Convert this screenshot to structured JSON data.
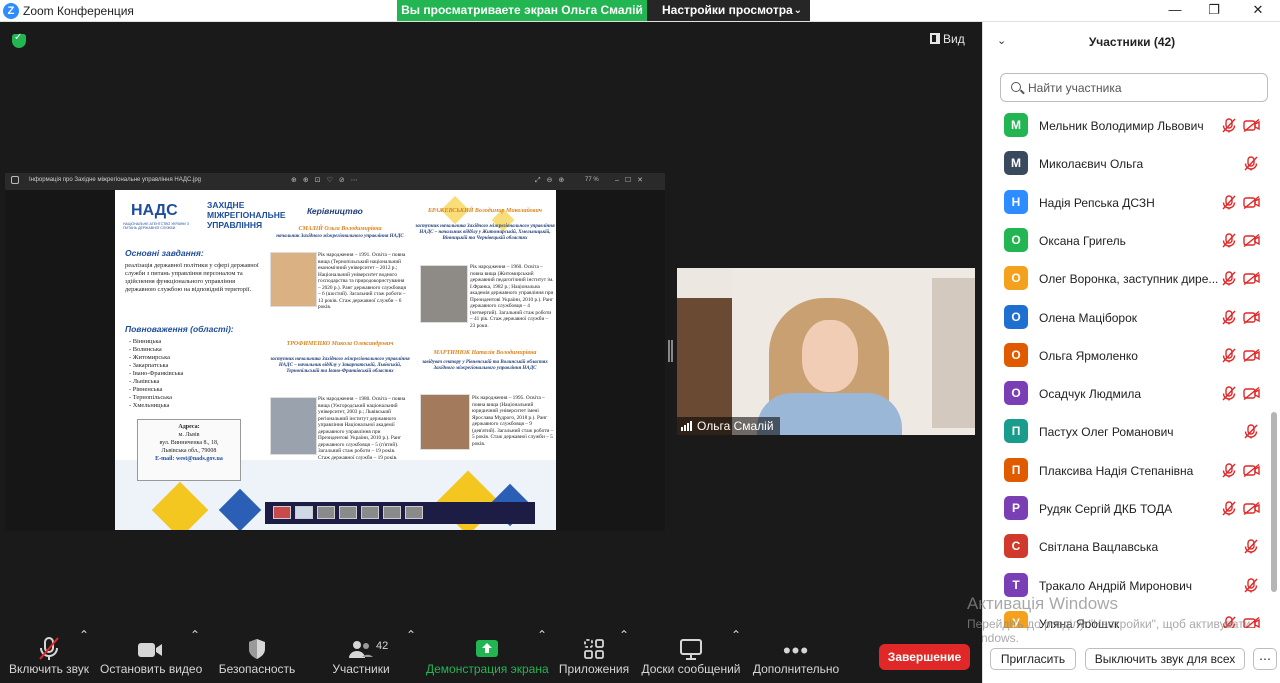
{
  "window": {
    "title": "Zoom Конференция",
    "share_banner": "Вы просматриваете экран Ольга Смалій",
    "view_settings": "Настройки просмотра"
  },
  "stage": {
    "view_label": "Вид",
    "camera_name": "Ольга Смалій",
    "share_filename": "Інформація про Західне міжрегіональне управління НАДС.jpg",
    "zoom_level": "77 %"
  },
  "document": {
    "logo": "НАДС",
    "logo_sub": "НАЦІОНАЛЬНЕ АГЕНТСТВО УКРАЇНИ З ПИТАНЬ ДЕРЖАВНОЇ СЛУЖБИ",
    "org": "ЗАХІДНЕ МІЖРЕГІОНАЛЬНЕ УПРАВЛІННЯ",
    "main_tasks_title": "Основні завдання:",
    "main_tasks_text": "реалізація державної політики у сфері державної служби з питань управління персоналом та здійснення функціонального управління державною службою на відповідній території.",
    "powers_title": "Повноваження (області):",
    "regions": [
      "- Вінницька",
      "- Волинська",
      "- Житомирська",
      "- Закарпатська",
      "- Івано-Франківська",
      "- Львівська",
      "- Рівненська",
      "- Тернопільська",
      "- Хмельницька"
    ],
    "address_title": "Адреса:",
    "address_lines": [
      "м. Львів",
      "вул. Винниченка 8., 18,",
      "Львівська обл., 79008"
    ],
    "email": "E-mail: west@nads.gov.ua",
    "leadership_title": "Керівництво",
    "p1_name": "СМАЛІЙ Ольга Володимирівна",
    "p1_pos": "начальник Західного міжрегіонального управління НАДС",
    "p1_bio": "Рік народження – 1991. Освіта – повна вища (Тернопільський національний економічний університет – 2012 р.; Національний університет водного господарства та природокористування – 2020 р.). Ранг державного службовця – 6 (шостий). Загальний стаж роботи – 13 років. Стаж державної служби – 6 років.",
    "p2_name": "ТРОФИМЕНКО Микола Олександрович",
    "p2_pos": "заступник начальника Західного міжрегіонального управління НАДС – начальник відділу у Закарпатській, Львівській, Тернопільській та Івано-Франківській областях",
    "p2_bio": "Рік народження – 1980. Освіта – повна вища (Ужгородський національний університет, 2003 р.; Львівський регіональний інститут державного управління Національної академії державного управління при Президентові України, 2010 р.). Ранг державного службовця – 5 (п'ятий). Загальний стаж роботи – 19 років. Стаж державної служби – 19 років.",
    "p3_name": "БРАЖЕВСЬКИЙ Володимир Миколайович",
    "p3_pos": "заступник начальника Західного міжрегіонального управління НАДС – начальник відділу у Житомирській, Хмельницькій, Вінницькій та Чернівецькій областях",
    "p3_bio": "Рік народження – 1960. Освіта – повна вища (Житомирський державний педагогічний інститут ім. І.Франка, 1982 р.; Національна академія державного управління при Президентові України, 2010 р.). Ранг державного службовця – 4 (четвертий). Загальний стаж роботи – 41 рік. Стаж державної служби – 23 роки.",
    "p4_name": "МАРТИНЮК Наталія Володимирівна",
    "p4_pos": "завідувач сектору у Рівненській та Волинській областях Західного міжрегіонального управління НАДС",
    "p4_bio": "Рік народження – 1995. Освіта – повна вища (Національний юридичний університет імені Ярослава Мудрого, 2018 р.). Ранг державного службовця – 9 (дев'ятий). Загальний стаж роботи – 5 років. Стаж державної служби – 5 років."
  },
  "panel": {
    "title": "Участники (42)",
    "search_placeholder": "Найти участника",
    "participants": [
      {
        "initial": "М",
        "name": "Мельник Володимир Львович",
        "color": "#23b552",
        "video": true
      },
      {
        "initial": "М",
        "name": "Миколаєвич Ольга",
        "color": "#3a4a5e",
        "video": false
      },
      {
        "initial": "Н",
        "name": "Надія Репська ДСЗН",
        "color": "#2d8cff",
        "video": true
      },
      {
        "initial": "О",
        "name": "Оксана Григель",
        "color": "#23b552",
        "video": true
      },
      {
        "initial": "О",
        "name": "Олег Воронка, заступник дире...",
        "color": "#f4a11d",
        "video": true
      },
      {
        "initial": "О",
        "name": "Олена Маціборок",
        "color": "#1e6fcf",
        "video": true
      },
      {
        "initial": "О",
        "name": "Ольга Ярмоленко",
        "color": "#e05a00",
        "video": true
      },
      {
        "initial": "О",
        "name": "Осадчук Людмила",
        "color": "#7b3fb5",
        "video": true
      },
      {
        "initial": "П",
        "name": "Пастух Олег Романович",
        "color": "#1a9c8c",
        "video": false
      },
      {
        "initial": "П",
        "name": "Плаксива Надія Степанівна",
        "color": "#e05a00",
        "video": true
      },
      {
        "initial": "Р",
        "name": "Рудяк Сергій ДКБ ТОДА",
        "color": "#7b3fb5",
        "video": true
      },
      {
        "initial": "С",
        "name": "Світлана  Вацлавська",
        "color": "#d0392b",
        "video": false
      },
      {
        "initial": "Т",
        "name": "Тракало Андрій Миронович",
        "color": "#7b3fb5",
        "video": false
      },
      {
        "initial": "У",
        "name": "Уляна Ярощук",
        "color": "#f4a11d",
        "video": true
      }
    ],
    "invite": "Пригласить",
    "mute_all": "Выключить звук для всех"
  },
  "watermark": {
    "line1": "Активація Windows",
    "line2": "Перейдіть до розділу \"Настройки\", щоб активувати Windows."
  },
  "toolbar": {
    "unmute": "Включить звук",
    "stop_video": "Остановить видео",
    "security": "Безопасность",
    "participants": "Участники",
    "participants_count": "42",
    "share": "Демонстрация экрана",
    "apps": "Приложения",
    "whiteboards": "Доски сообщений",
    "more": "Дополнительно",
    "end": "Завершение",
    "share_color": "#23b552",
    "end_color": "#e02828"
  }
}
